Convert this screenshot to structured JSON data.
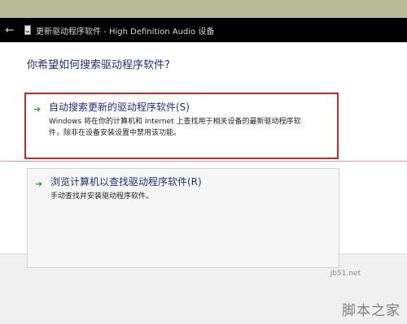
{
  "titlebar": {
    "title": "更新驱动程序软件 - High Definition Audio 设备"
  },
  "main": {
    "heading": "你希望如何搜索驱动程序软件?",
    "options": [
      {
        "title": "自动搜索更新的驱动程序软件(S)",
        "desc_line1": "Windows 将在你的计算机和 Internet 上查找用于相关设备的最新驱动程序软",
        "desc_line2": "件，除非在设备安装设置中禁用该功能。"
      },
      {
        "title": "浏览计算机以查找驱动程序软件(R)",
        "desc_line1": "手动查找并安装驱动程序软件。"
      }
    ]
  },
  "watermark": {
    "domain": "jb51.net",
    "logo": "脚本之家"
  },
  "colors": {
    "highlight_border": "#c8282c",
    "link_text": "#1e3287",
    "arrow": "#2e9e30"
  },
  "icons": [
    "back-arrow-icon",
    "device-icon",
    "green-arrow-icon"
  ]
}
